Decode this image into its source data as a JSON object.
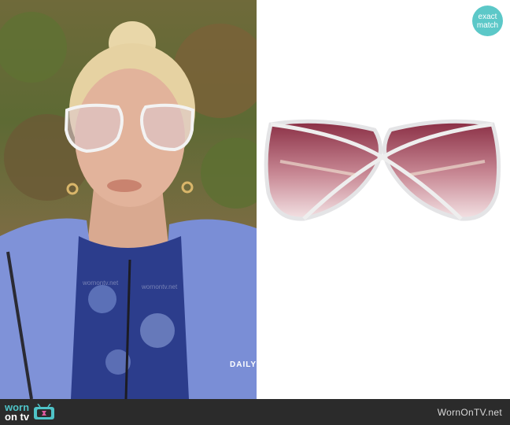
{
  "badge": {
    "line1": "exact",
    "line2": "match",
    "color": "#5cc8c8"
  },
  "footer": {
    "logo_worn": "worn",
    "logo_on": "on",
    "logo_tv": "tv",
    "site": "WornOnTV.net"
  },
  "photo": {
    "jacket_text": "DAILY",
    "watermark": "wornontv.net"
  }
}
